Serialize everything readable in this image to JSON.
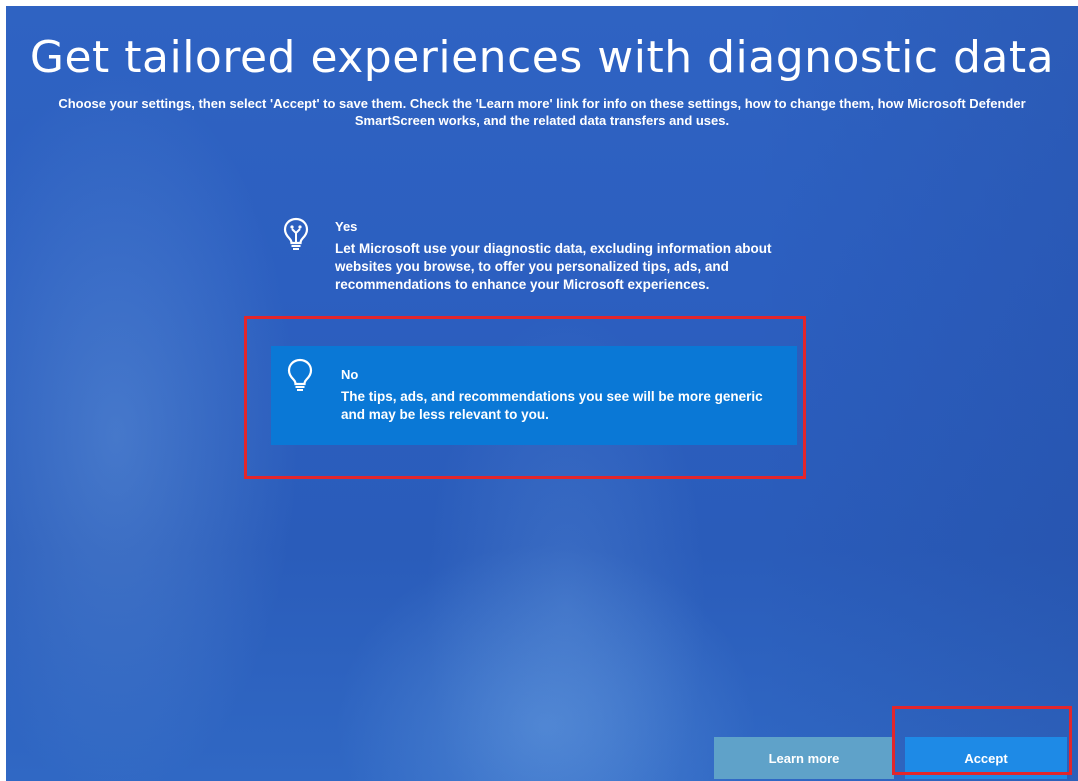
{
  "page": {
    "title": "Get tailored experiences with diagnostic data",
    "subtitle": "Choose your settings, then select 'Accept' to save them. Check the 'Learn more' link for info on these settings, how to change them, how Microsoft Defender SmartScreen works, and the related data transfers and uses."
  },
  "options": [
    {
      "title": "Yes",
      "description": "Let Microsoft use your diagnostic data, excluding information about websites you browse, to offer you personalized tips, ads, and recommendations to enhance your Microsoft experiences.",
      "icon": "lightbulb-on-icon",
      "selected": false
    },
    {
      "title": "No",
      "description": "The tips, ads, and recommendations you see will be more generic and may be less relevant to you.",
      "icon": "lightbulb-off-icon",
      "selected": true
    }
  ],
  "buttons": {
    "learn_more": "Learn more",
    "accept": "Accept"
  },
  "colors": {
    "background": "#2c5fc0",
    "selected_option": "#0a78d6",
    "accept_button": "#1e8ae6",
    "learn_more_button": "#5fa2c9",
    "annotation_red": "#e3262b"
  }
}
